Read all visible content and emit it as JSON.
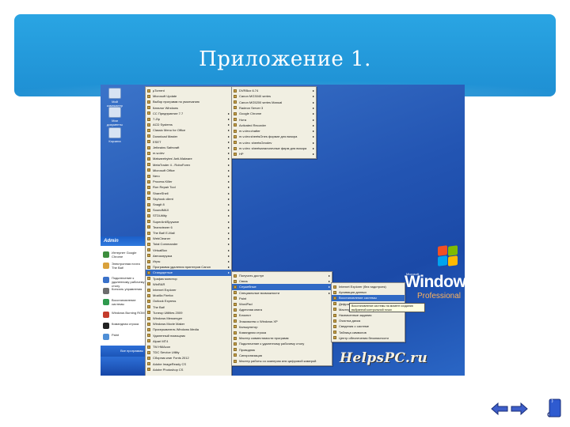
{
  "slide": {
    "title": "Приложение 1."
  },
  "desktop": {
    "icons": [
      "Мой компьютер",
      "Мои документы",
      "Корзина"
    ]
  },
  "start_menu": {
    "user": "Admin",
    "pinned": [
      "Интернет Google Chrome",
      "Электронная почта The Bat!",
      "Подключение к удаленному рабочему столу",
      "Консоль управления",
      "Восстановление системы",
      "Windows Burning ROM",
      "Командная строка",
      "Paint"
    ],
    "all_programs": "Все программы"
  },
  "menu_programs": [
    "µTorrent",
    "Microsoft Update",
    "Выбор программ по умолчанию",
    "Каталог Windows",
    "CC Предприятие 7.7",
    "7-Zip",
    "ACD Systems",
    "Classic Menu for Office",
    "Download Master",
    "ESET",
    "Jetbrains Safecraft",
    "m.w.dev",
    "Malwarebytes' Anti-Malware",
    "MetaTrader 4 - RoboForex",
    "Microsoft Office",
    "Nero",
    "Process Killer",
    "Ron Repair Tool",
    "ShareShell",
    "Skyhook client",
    "Snagit 8",
    "SoundMAX",
    "STDUtility",
    "SuperAntiSpyware",
    "Teamviewer 6",
    "The Bat! E-Mail",
    "WebCleaner",
    "Total Commander",
    "VirtualBox",
    "Автозагрузка",
    "Игры",
    "Программа удаления принтеров Canon",
    "Стандартные",
    "Трафик монитор",
    "WinRAR",
    "Internet Explorer",
    "Mozilla Firefox",
    "Outlook Express",
    "The Bat!",
    "Tuneup Utilities 2009",
    "Windows Messenger",
    "Windows Movie Maker",
    "Проигрыватель Windows Media",
    "Удаленный помощник",
    "Alpari MT4",
    "TM HMAcon",
    "TDC Service Utility",
    "Сборник книг Fonts 2012",
    "Adobe ImageReady CS",
    "Adobe Photoshop CS"
  ],
  "menu_sub1_top": [
    "DVRBox 6.74",
    "Canon MG3040 series",
    "Canon MG5200 series Manual",
    "Radeon Server 3",
    "Google Chrome",
    "Нота",
    "Activated Recorder",
    "m.v.dev.chatter",
    "m.v.dev.sheetsOnes  формат для визора",
    "m.v.dev. sheetsGeodev",
    "m.v.dev. sheetsаналогичные фирм для визора",
    "HP"
  ],
  "menu_accessories": [
    "Получить доступ",
    "Связь",
    "Служебные",
    "Специальные возможности",
    "Paint",
    "WordPad",
    "Адресная книга",
    "Блокнот",
    "Знакомство с Windows XP",
    "Калькулятор",
    "Командная строка",
    "Мастер совместимости программ",
    "Подключение к удаленному рабочему столу",
    "Проводник",
    "Синхронизация",
    "Мастер работы со сканером или цифровой камерой"
  ],
  "menu_system_tools": [
    "Internet Explorer (без надстроек)",
    "Архивация данных",
    "Восстановление системы",
    "Дефрагментация диска",
    "Мастер переноса файлов и параметров",
    "Назначенные задания",
    "Очистка диска",
    "Сведения о системе",
    "Таблица символов",
    "Центр обеспечения безопасности"
  ],
  "tooltip": "Восстановление системы на момент создания выбранной контрольной точки",
  "branding": {
    "microsoft": "Microsoft",
    "windows": "Windows",
    "xp": "xp",
    "edition": "Professional"
  },
  "watermark": "HelpsPC.ru",
  "colors": {
    "banner": "#1e8fd3",
    "highlight": "#316ac5",
    "arrow": "#3d5ec9"
  },
  "icons": {
    "prev": "left-arrow-icon",
    "next": "right-arrow-icon",
    "doc": "document-icon"
  }
}
